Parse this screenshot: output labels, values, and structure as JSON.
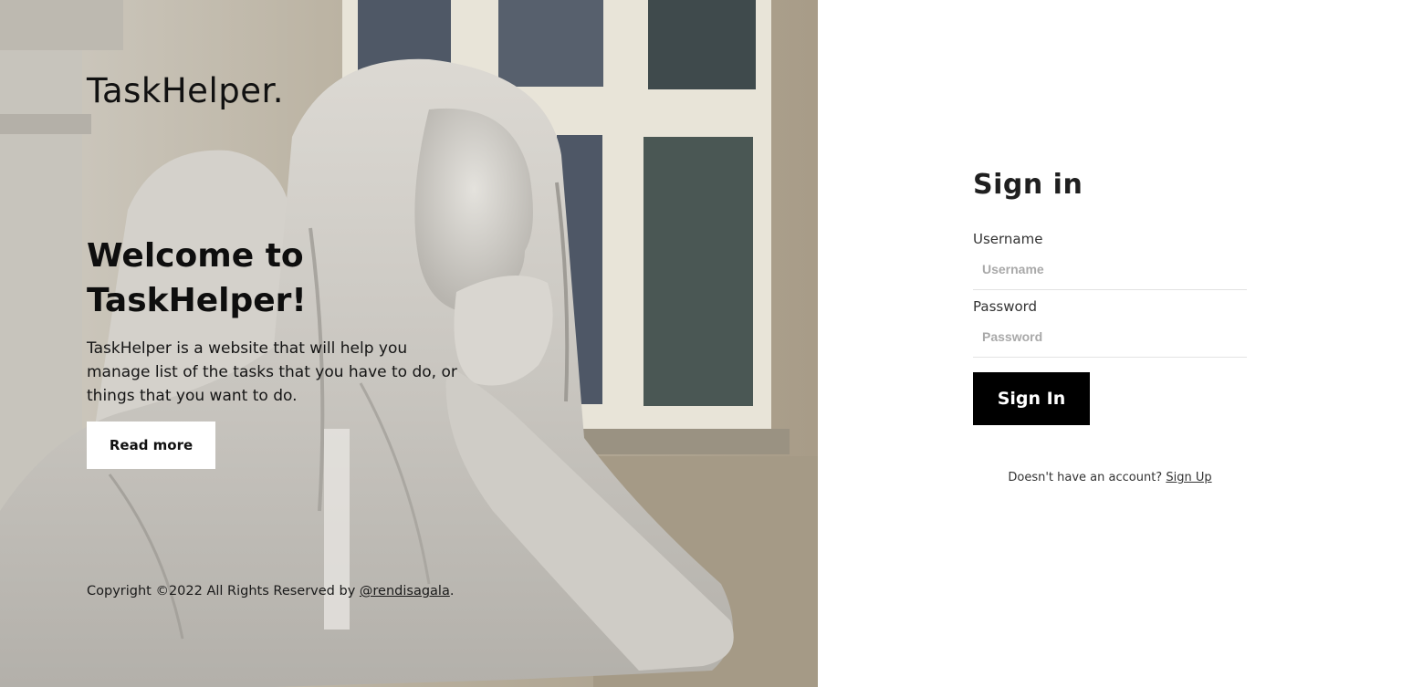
{
  "hero": {
    "brand": "TaskHelper.",
    "welcome_title": "Welcome to TaskHelper!",
    "intro": "TaskHelper is a website that will help you manage list of the tasks that you have to do, or things that you want to do.",
    "read_more_label": "Read more",
    "copyright_prefix": "Copyright ©2022 All Rights Reserved by ",
    "copyright_link": "@rendisagala",
    "copyright_suffix": "."
  },
  "signin": {
    "title": "Sign in",
    "username_label": "Username",
    "username_placeholder": "Username",
    "password_label": "Password",
    "password_placeholder": "Password",
    "submit_label": "Sign In",
    "signup_prompt": "Doesn't have an account? ",
    "signup_link": "Sign Up"
  }
}
